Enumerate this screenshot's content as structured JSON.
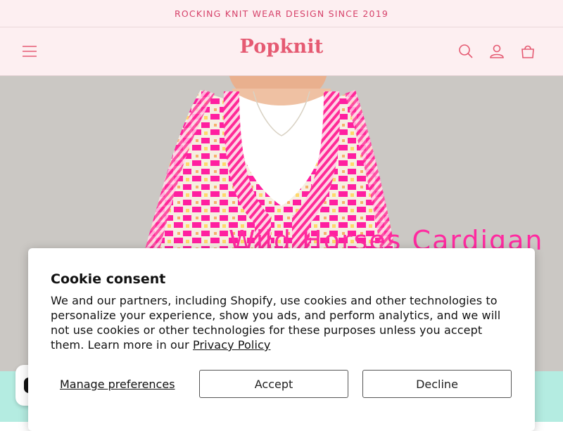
{
  "announcement": {
    "text": "ROCKING KNIT WEAR DESIGN SINCE 2019"
  },
  "header": {
    "logo": "Popknit",
    "icons": {
      "menu": "menu-icon",
      "search": "search-icon",
      "account": "account-icon",
      "cart": "cart-icon"
    },
    "accent_color": "#e55a72",
    "background_color": "#fdeff1"
  },
  "hero": {
    "title": "Wild Horses Cardigan",
    "title_color": "#ff2aa0"
  },
  "cookie_banner": {
    "title": "Cookie consent",
    "body_text": "We and our partners, including Shopify, use cookies and other technologies to personalize your experience, show you ads, and perform analytics, and we will not use cookies or other technologies for these purposes unless you accept them. Learn more in our ",
    "privacy_link": "Privacy Policy",
    "manage_label": "Manage preferences",
    "accept_label": "Accept",
    "decline_label": "Decline"
  },
  "colors": {
    "teal_band": "#b4ece1"
  }
}
